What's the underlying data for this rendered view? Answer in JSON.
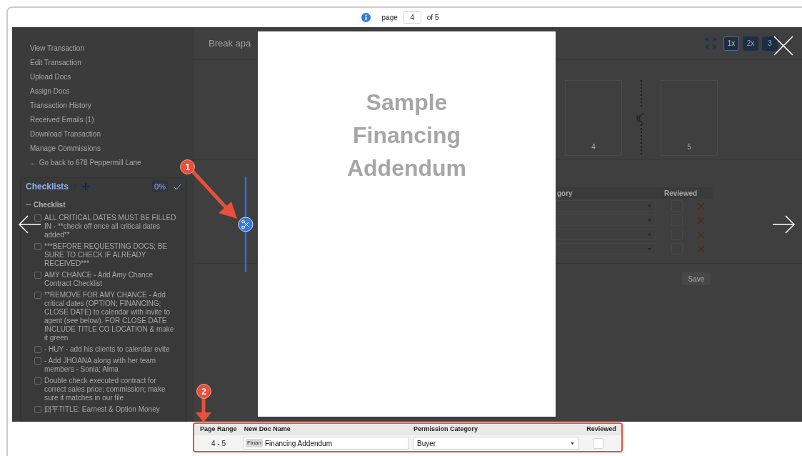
{
  "pager": {
    "label": "page",
    "value": "4",
    "total": "of 5"
  },
  "sidebar": {
    "links": [
      "View Transaction",
      "Edit Transaction",
      "Upload Docs",
      "Assign Docs",
      "Transaction History",
      "Received Emails (1)",
      "Download Transaction",
      "Manage Commissions",
      "← Go back to 678 Peppermill Lane"
    ],
    "checklists": {
      "title": "Checklists",
      "percent": "0%",
      "group": "Checklist",
      "expanded": true,
      "items": [
        {
          "text": "ALL CRITICAL DATES MUST BE FILLED IN - **check off once all critical dates added**",
          "checked": false
        },
        {
          "text": "***BEFORE REQUESTING DOCS; BE SURE TO CHECK IF ALREADY RECEIVED***",
          "checked": false
        },
        {
          "text": "AMY CHANCE - Add Amy Chance Contract Checklist",
          "checked": false
        },
        {
          "text": "**REMOVE FOR AMY CHANCE - Add critical dates (OPTION; FINANCING; CLOSE DATE) to calendar with invite to agent (see below). FOR CLOSE DATE INCLUDE TITLE CO LOCATION & make it green",
          "checked": false
        },
        {
          "text": "- HUY - add his clients to calendar evite",
          "checked": false
        },
        {
          "text": "- Add JHOANA along with her team members - Sonia; Alma",
          "checked": false
        },
        {
          "text": "Double check executed contract for correct sales price; commission; make sure it matches in our file",
          "checked": false
        },
        {
          "text": "囧平TITLE: Earnest & Option Money",
          "checked": false
        }
      ]
    }
  },
  "main": {
    "title": "Break apa",
    "zoom_buttons": [
      {
        "label": "1x",
        "selected": true
      },
      {
        "label": "2x",
        "selected": false
      },
      {
        "label": "3",
        "selected": false
      }
    ],
    "thumbnails": [
      {
        "number": "4"
      },
      {
        "number": "5"
      }
    ],
    "table": {
      "columns": [
        "gory",
        "Reviewed"
      ],
      "rows": [
        {
          "reviewed": false
        },
        {
          "reviewed": false
        },
        {
          "reviewed": false
        },
        {
          "reviewed": false
        }
      ]
    },
    "save": "Save"
  },
  "document": {
    "lines": [
      "Sample",
      "Financing",
      "Addendum"
    ]
  },
  "callouts": [
    "1",
    "2"
  ],
  "split_table": {
    "columns": [
      "Page Range",
      "New Doc Name",
      "Permission Category",
      "Reviewed"
    ],
    "rows": [
      {
        "page_range": "4 - 5",
        "tag": "Finan",
        "name": "Financing Addendum",
        "category": "Buyer",
        "reviewed": false
      }
    ]
  }
}
